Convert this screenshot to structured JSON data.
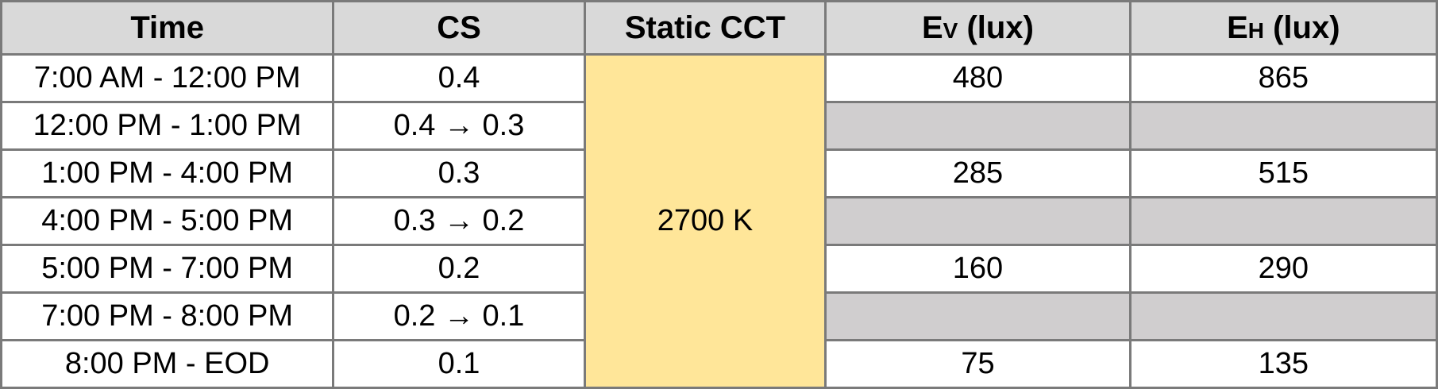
{
  "table": {
    "headers": {
      "time": "Time",
      "cs": "CS",
      "cct": "Static CCT",
      "ev_main": "E",
      "ev_sub": "V",
      "ev_unit": " (lux)",
      "eh_main": "E",
      "eh_sub": "H",
      "eh_unit": " (lux)"
    },
    "cct_value": "2700 K",
    "rows": [
      {
        "time": "7:00 AM - 12:00 PM",
        "cs": "0.4",
        "ev": "480",
        "eh": "865",
        "shaded": false
      },
      {
        "time": "12:00 PM - 1:00 PM",
        "cs": "0.4 → 0.3",
        "ev": "",
        "eh": "",
        "shaded": true
      },
      {
        "time": "1:00 PM - 4:00 PM",
        "cs": "0.3",
        "ev": "285",
        "eh": "515",
        "shaded": false
      },
      {
        "time": "4:00 PM - 5:00 PM",
        "cs": "0.3 → 0.2",
        "ev": "",
        "eh": "",
        "shaded": true
      },
      {
        "time": "5:00 PM - 7:00 PM",
        "cs": "0.2",
        "ev": "160",
        "eh": "290",
        "shaded": false
      },
      {
        "time": "7:00 PM - 8:00 PM",
        "cs": "0.2 → 0.1",
        "ev": "",
        "eh": "",
        "shaded": true
      },
      {
        "time": "8:00 PM - EOD",
        "cs": "0.1",
        "ev": "75",
        "eh": "135",
        "shaded": false
      }
    ]
  },
  "colors": {
    "header_bg": "#d9d9d9",
    "cct_bg": "#ffe699",
    "shaded_bg": "#d0cecf",
    "border": "#7a7a7a"
  }
}
